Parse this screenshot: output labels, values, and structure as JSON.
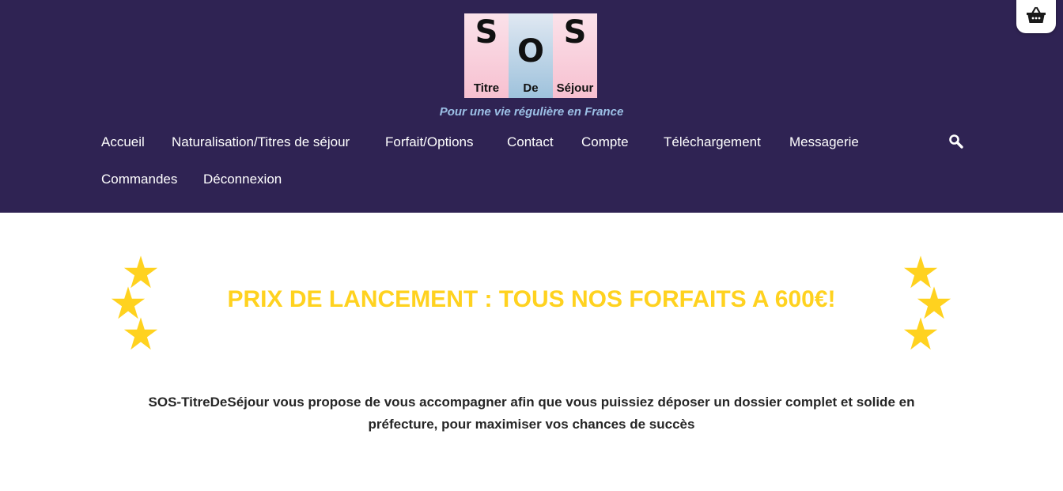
{
  "logo": {
    "letters": [
      "S",
      "O",
      "S"
    ],
    "words": [
      "Titre",
      "De",
      "Séjour"
    ]
  },
  "tagline": "Pour une vie régulière en France",
  "nav": {
    "items": [
      "Accueil",
      "Naturalisation/Titres de séjour",
      "Forfait/Options",
      "Contact",
      "Compte",
      "Téléchargement",
      "Messagerie",
      "Commandes",
      "Déconnexion"
    ]
  },
  "icons": {
    "search": "search-icon",
    "cart": "basket-icon",
    "star": "star-icon"
  },
  "colors": {
    "header_bg": "#2f2353",
    "nav_text": "#ffffff",
    "tagline": "#9cc0e6",
    "promo": "#ffd21f",
    "body_text": "#262626"
  },
  "promo": "PRIX DE LANCEMENT : TOUS NOS FORFAITS A 600€!",
  "description": "SOS-TitreDeSéjour vous propose de vous accompagner afin que vous puissiez déposer un dossier complet et solide en préfecture, pour maximiser vos chances de succès"
}
